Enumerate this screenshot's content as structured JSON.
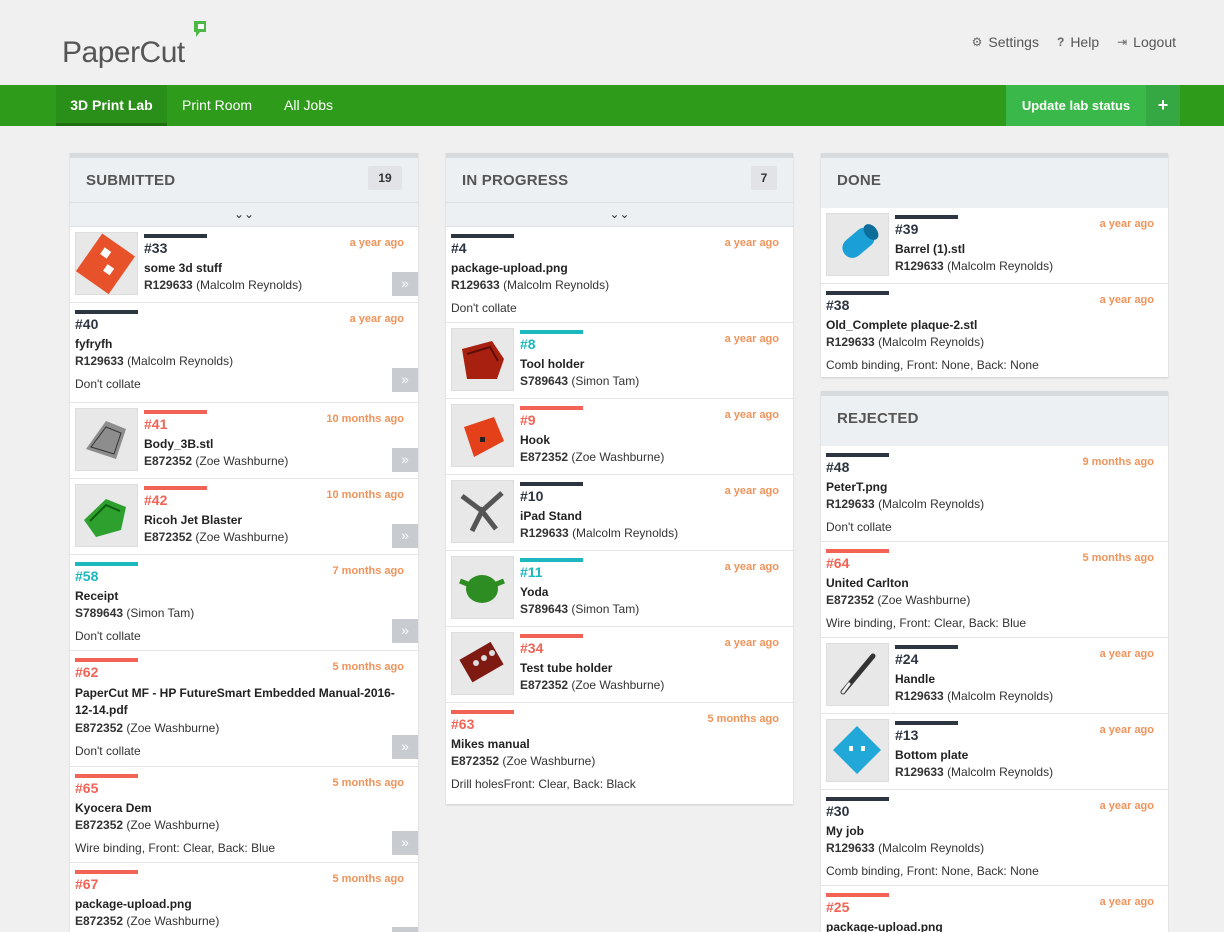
{
  "header": {
    "logo_text": "PaperCut",
    "links": [
      {
        "label": "Settings",
        "icon": "gear-icon"
      },
      {
        "label": "Help",
        "icon": "question-icon"
      },
      {
        "label": "Logout",
        "icon": "logout-icon"
      }
    ]
  },
  "nav": {
    "tabs": [
      "3D Print Lab",
      "Print Room",
      "All Jobs"
    ],
    "update_label": "Update lab status",
    "plus_label": "+"
  },
  "colors": {
    "brand_green": "#2e9c1a",
    "button_green": "#3ab94a",
    "time_orange": "#f0935a",
    "red": "#f26355",
    "teal": "#1bb8bd",
    "dark": "#2d3540"
  },
  "columns": {
    "submitted": {
      "title": "SUBMITTED",
      "count": "19",
      "collapse": "⌄"
    },
    "in_progress": {
      "title": "IN PROGRESS",
      "count": "7",
      "collapse": "⌄"
    },
    "done": {
      "title": "DONE"
    },
    "rejected": {
      "title": "REJECTED"
    }
  },
  "submitted_jobs": [
    {
      "num": "#33",
      "name": "some 3d stuff",
      "user_id": "R129633",
      "user_name": "(Malcolm Reynolds)",
      "time": "a year ago",
      "note": ""
    },
    {
      "num": "#40",
      "name": "fyfryfh",
      "user_id": "R129633",
      "user_name": "(Malcolm Reynolds)",
      "time": "a year ago",
      "note": "Don't collate"
    },
    {
      "num": "#41",
      "name": "Body_3B.stl",
      "user_id": "E872352",
      "user_name": "(Zoe Washburne)",
      "time": "10 months ago",
      "note": ""
    },
    {
      "num": "#42",
      "name": "Ricoh Jet Blaster",
      "user_id": "E872352",
      "user_name": "(Zoe Washburne)",
      "time": "10 months ago",
      "note": ""
    },
    {
      "num": "#58",
      "name": "Receipt",
      "user_id": "S789643",
      "user_name": "(Simon Tam)",
      "time": "7 months ago",
      "note": "Don't collate"
    },
    {
      "num": "#62",
      "name": "PaperCut MF - HP FutureSmart Embedded Manual-2016-12-14.pdf",
      "user_id": "E872352",
      "user_name": "(Zoe Washburne)",
      "time": "5 months ago",
      "note": "Don't collate"
    },
    {
      "num": "#65",
      "name": "Kyocera Dem",
      "user_id": "E872352",
      "user_name": "(Zoe Washburne)",
      "time": "5 months ago",
      "note": "Wire binding, Front: Clear, Back: Blue"
    },
    {
      "num": "#67",
      "name": "package-upload.png",
      "user_id": "E872352",
      "user_name": "(Zoe Washburne)",
      "time": "5 months ago",
      "note": ""
    }
  ],
  "in_progress_jobs": [
    {
      "num": "#4",
      "name": "package-upload.png",
      "user_id": "R129633",
      "user_name": "(Malcolm Reynolds)",
      "time": "a year ago",
      "note": "Don't collate"
    },
    {
      "num": "#8",
      "name": "Tool holder",
      "user_id": "S789643",
      "user_name": "(Simon Tam)",
      "time": "a year ago",
      "note": ""
    },
    {
      "num": "#9",
      "name": "Hook",
      "user_id": "E872352",
      "user_name": "(Zoe Washburne)",
      "time": "a year ago",
      "note": ""
    },
    {
      "num": "#10",
      "name": "iPad Stand",
      "user_id": "R129633",
      "user_name": "(Malcolm Reynolds)",
      "time": "a year ago",
      "note": ""
    },
    {
      "num": "#11",
      "name": "Yoda",
      "user_id": "S789643",
      "user_name": "(Simon Tam)",
      "time": "a year ago",
      "note": ""
    },
    {
      "num": "#34",
      "name": "Test tube holder",
      "user_id": "E872352",
      "user_name": "(Zoe Washburne)",
      "time": "a year ago",
      "note": ""
    },
    {
      "num": "#63",
      "name": "Mikes manual",
      "user_id": "E872352",
      "user_name": "(Zoe Washburne)",
      "time": "5 months ago",
      "note": "Drill holesFront: Clear, Back: Black"
    }
  ],
  "done_jobs": [
    {
      "num": "#39",
      "name": "Barrel (1).stl",
      "user_id": "R129633",
      "user_name": "(Malcolm Reynolds)",
      "time": "a year ago",
      "note": ""
    },
    {
      "num": "#38",
      "name": "Old_Complete plaque-2.stl",
      "user_id": "R129633",
      "user_name": "(Malcolm Reynolds)",
      "time": "a year ago",
      "note": "Comb binding, Front: None, Back: None"
    }
  ],
  "rejected_jobs": [
    {
      "num": "#48",
      "name": "PeterT.png",
      "user_id": "R129633",
      "user_name": "(Malcolm Reynolds)",
      "time": "9 months ago",
      "note": "Don't collate"
    },
    {
      "num": "#64",
      "name": "United Carlton",
      "user_id": "E872352",
      "user_name": "(Zoe Washburne)",
      "time": "5 months ago",
      "note": "Wire binding, Front: Clear, Back: Blue"
    },
    {
      "num": "#24",
      "name": "Handle",
      "user_id": "R129633",
      "user_name": "(Malcolm Reynolds)",
      "time": "a year ago",
      "note": ""
    },
    {
      "num": "#13",
      "name": "Bottom plate",
      "user_id": "R129633",
      "user_name": "(Malcolm Reynolds)",
      "time": "a year ago",
      "note": ""
    },
    {
      "num": "#30",
      "name": "My job",
      "user_id": "R129633",
      "user_name": "(Malcolm Reynolds)",
      "time": "a year ago",
      "note": "Comb binding, Front: None, Back: None"
    },
    {
      "num": "#25",
      "name": "package-upload.png",
      "user_id": "",
      "user_name": "",
      "time": "a year ago",
      "note": ""
    }
  ]
}
